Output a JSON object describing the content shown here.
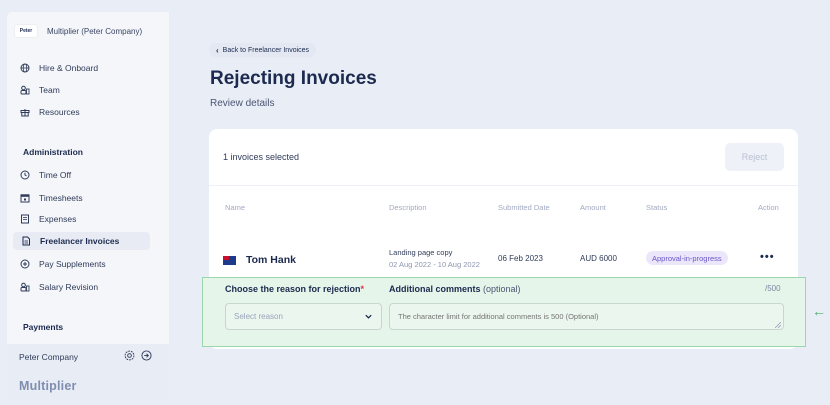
{
  "sidebar": {
    "logo_text": "Peter",
    "company_label": "Multiplier (Peter Company)",
    "top_items": [
      {
        "label": "Hire & Onboard",
        "icon": "globe-icon"
      },
      {
        "label": "Team",
        "icon": "team-icon"
      },
      {
        "label": "Resources",
        "icon": "gift-icon"
      }
    ],
    "admin_title": "Administration",
    "admin_items": [
      {
        "label": "Time Off",
        "icon": "clock-icon"
      },
      {
        "label": "Timesheets",
        "icon": "calendar-icon"
      },
      {
        "label": "Expenses",
        "icon": "receipt-icon"
      },
      {
        "label": "Freelancer Invoices",
        "icon": "invoice-icon",
        "active": true
      },
      {
        "label": "Pay Supplements",
        "icon": "plus-circle-icon"
      },
      {
        "label": "Salary Revision",
        "icon": "team-icon"
      }
    ],
    "payments_title": "Payments",
    "company_switch": "Peter Company",
    "brand": "Multiplier"
  },
  "header": {
    "back_label": "Back to Freelancer Invoices",
    "title": "Rejecting Invoices",
    "subtitle": "Review details"
  },
  "card": {
    "selected_count": "1 invoices selected",
    "reject_label": "Reject",
    "columns": [
      "Name",
      "Description",
      "Submitted Date",
      "Amount",
      "Status",
      "Action"
    ],
    "row": {
      "name": "Tom Hank",
      "description": "Landing page copy",
      "date_range": "02 Aug 2022 - 10 Aug 2022",
      "submitted": "06 Feb 2023",
      "amount": "AUD 6000",
      "status": "Approval-in-progress",
      "action": "•••"
    }
  },
  "rejection": {
    "reason_label": "Choose the reason for rejection",
    "required_mark": "*",
    "reason_placeholder": "Select reason",
    "comments_label": "Additional comments",
    "comments_optional": "(optional)",
    "char_limit": "/500",
    "comments_placeholder": "The character limit for additional comments is 500 (Optional)"
  },
  "colors": {
    "accent": "#1b2a4e",
    "status_bg": "#ece6fb",
    "status_text": "#6c55c8",
    "panel_highlight": "#e6f5ea"
  }
}
